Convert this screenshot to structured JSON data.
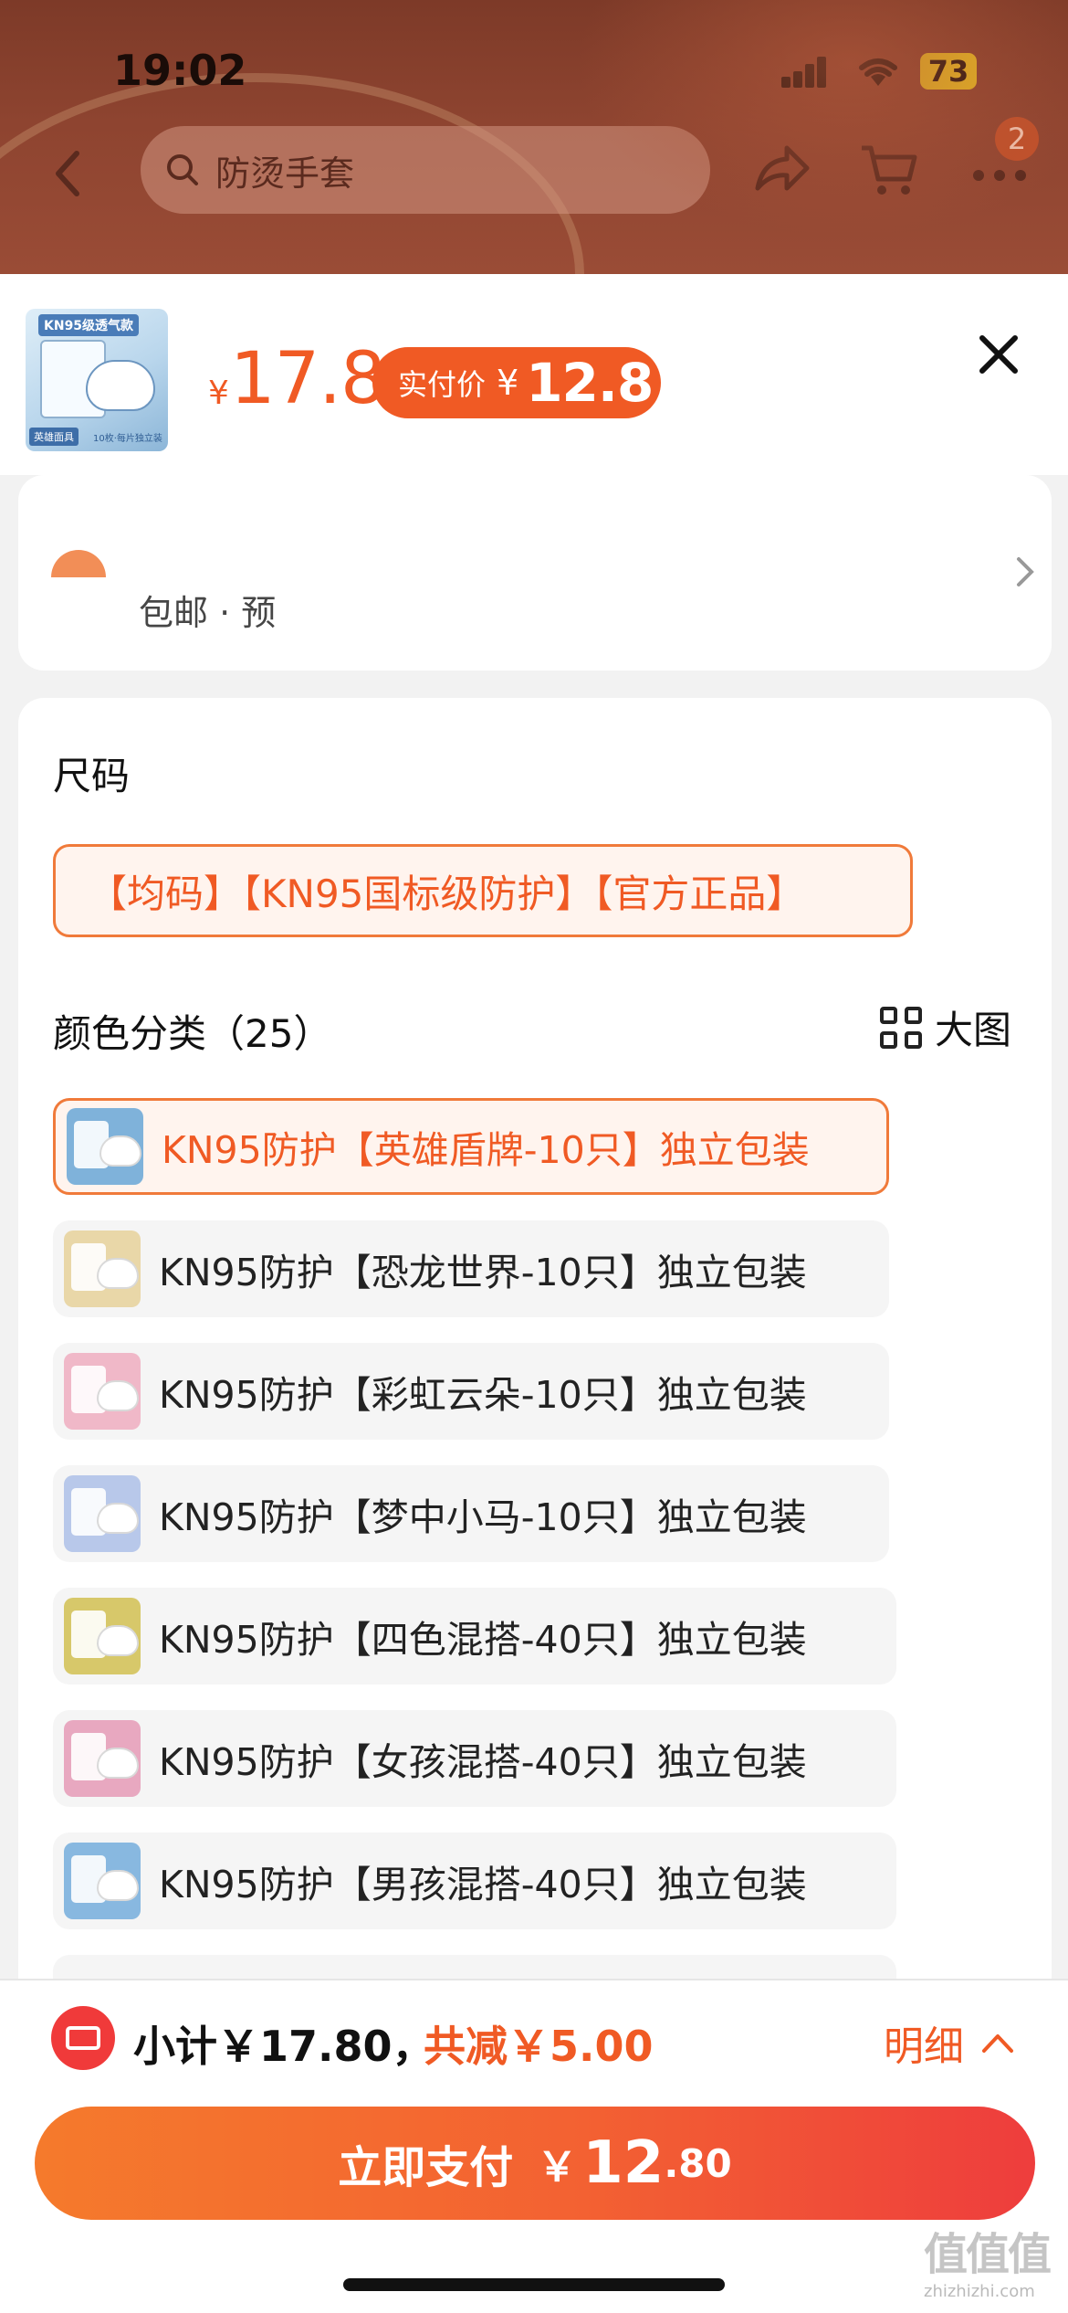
{
  "status": {
    "time": "19:02",
    "battery": "73"
  },
  "nav": {
    "search_placeholder": "防烫手套",
    "cart_badge": "2"
  },
  "product": {
    "price_currency": "¥",
    "price": "17.8",
    "paid_label": "实付价",
    "paid_currency": "¥",
    "paid_price": "12.8",
    "thumb_title": "KN95级透气款",
    "thumb_tag": "英雄面具",
    "thumb_note": "10枚·每片独立装"
  },
  "address": {
    "text": "包邮 · 预"
  },
  "size": {
    "title": "尺码",
    "option": "【均码】【KN95国标级防护】【官方正品】"
  },
  "colors": {
    "title": "颜色分类（25）",
    "big_view_label": "大图",
    "options": [
      {
        "label": "KN95防护【英雄盾牌-10只】独立包装",
        "selected": true,
        "thumb_color": "#7fb2da"
      },
      {
        "label": "KN95防护【恐龙世界-10只】独立包装",
        "selected": false,
        "thumb_color": "#e9d7a8"
      },
      {
        "label": "KN95防护【彩虹云朵-10只】独立包装",
        "selected": false,
        "thumb_color": "#f0b8c8"
      },
      {
        "label": "KN95防护【梦中小马-10只】独立包装",
        "selected": false,
        "thumb_color": "#b8c8ea"
      },
      {
        "label": "KN95防护【四色混搭-40只】独立包装",
        "selected": false,
        "thumb_color": "#d7c86a"
      },
      {
        "label": "KN95防护【女孩混搭-40只】独立包装",
        "selected": false,
        "thumb_color": "#e8a8c0"
      },
      {
        "label": "KN95防护【男孩混搭-40只】独立包装",
        "selected": false,
        "thumb_color": "#88b8e0"
      }
    ]
  },
  "footer": {
    "subtotal": "小计￥17.80，",
    "reduction": "共减￥5.00",
    "detail_label": "明细",
    "pay_label": "立即支付",
    "pay_currency": "￥",
    "pay_int": "12",
    "pay_dec": ".80"
  },
  "watermark": {
    "glyph": "值值值",
    "url": "zhizhizhi.com"
  },
  "colors_theme": {
    "accent": "#f05a24",
    "danger": "#f03a3a"
  }
}
